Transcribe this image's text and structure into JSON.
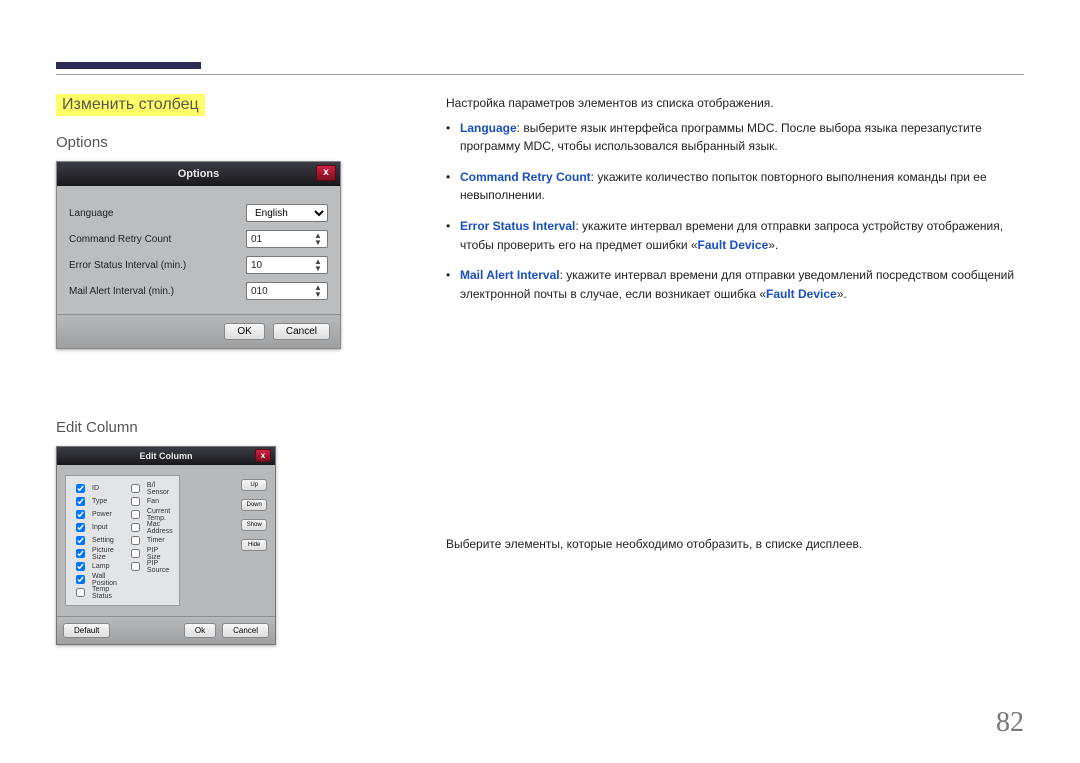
{
  "header": {
    "section_title": "Изменить столбец"
  },
  "subsections": {
    "options": "Options",
    "edit_column": "Edit Column"
  },
  "options_dialog": {
    "title": "Options",
    "rows": {
      "language_label": "Language",
      "language_value": "English",
      "retry_label": "Command Retry Count",
      "retry_value": "01",
      "error_label": "Error Status Interval (min.)",
      "error_value": "10",
      "mail_label": "Mail Alert Interval (min.)",
      "mail_value": "010"
    },
    "ok": "OK",
    "cancel": "Cancel"
  },
  "edit_column_dialog": {
    "title": "Edit Column",
    "col1": [
      "ID",
      "Type",
      "Power",
      "Input",
      "Setting",
      "Picture Size",
      "Lamp",
      "Wall Position",
      "Temp Status"
    ],
    "col1_checked": [
      true,
      true,
      true,
      true,
      true,
      true,
      true,
      true,
      false
    ],
    "col2": [
      "B/l Sensor",
      "Fan",
      "Current Temp.",
      "Mac Address",
      "Timer",
      "PIP Size",
      "PIP Source"
    ],
    "col2_checked": [
      false,
      false,
      false,
      false,
      false,
      false,
      false
    ],
    "side_btns": [
      "Up",
      "Down",
      "Show",
      "Hide"
    ],
    "default": "Default",
    "ok": "Ok",
    "cancel": "Cancel"
  },
  "right": {
    "intro": "Настройка параметров элементов из списка отображения.",
    "items": [
      {
        "key": "Language",
        "text": ": выберите язык интерфейса программы MDC. После выбора языка перезапустите программу MDC, чтобы использовался выбранный язык."
      },
      {
        "key": "Command Retry Count",
        "text": ": укажите количество попыток повторного выполнения команды при ее невыполнении."
      },
      {
        "key": "Error Status Interval",
        "text_before": ": укажите интервал времени для отправки запроса устройству отображения, чтобы проверить его на предмет ошибки «",
        "fault": "Fault Device",
        "text_after": "»."
      },
      {
        "key": "Mail Alert Interval",
        "text_before": ": укажите интервал времени для отправки уведомлений посредством сообщений электронной почты в случае, если возникает ошибка «",
        "fault": "Fault Device",
        "text_after": "»."
      }
    ],
    "edit_column_desc": "Выберите элементы, которые необходимо отобразить, в списке дисплеев."
  },
  "page_number": "82"
}
